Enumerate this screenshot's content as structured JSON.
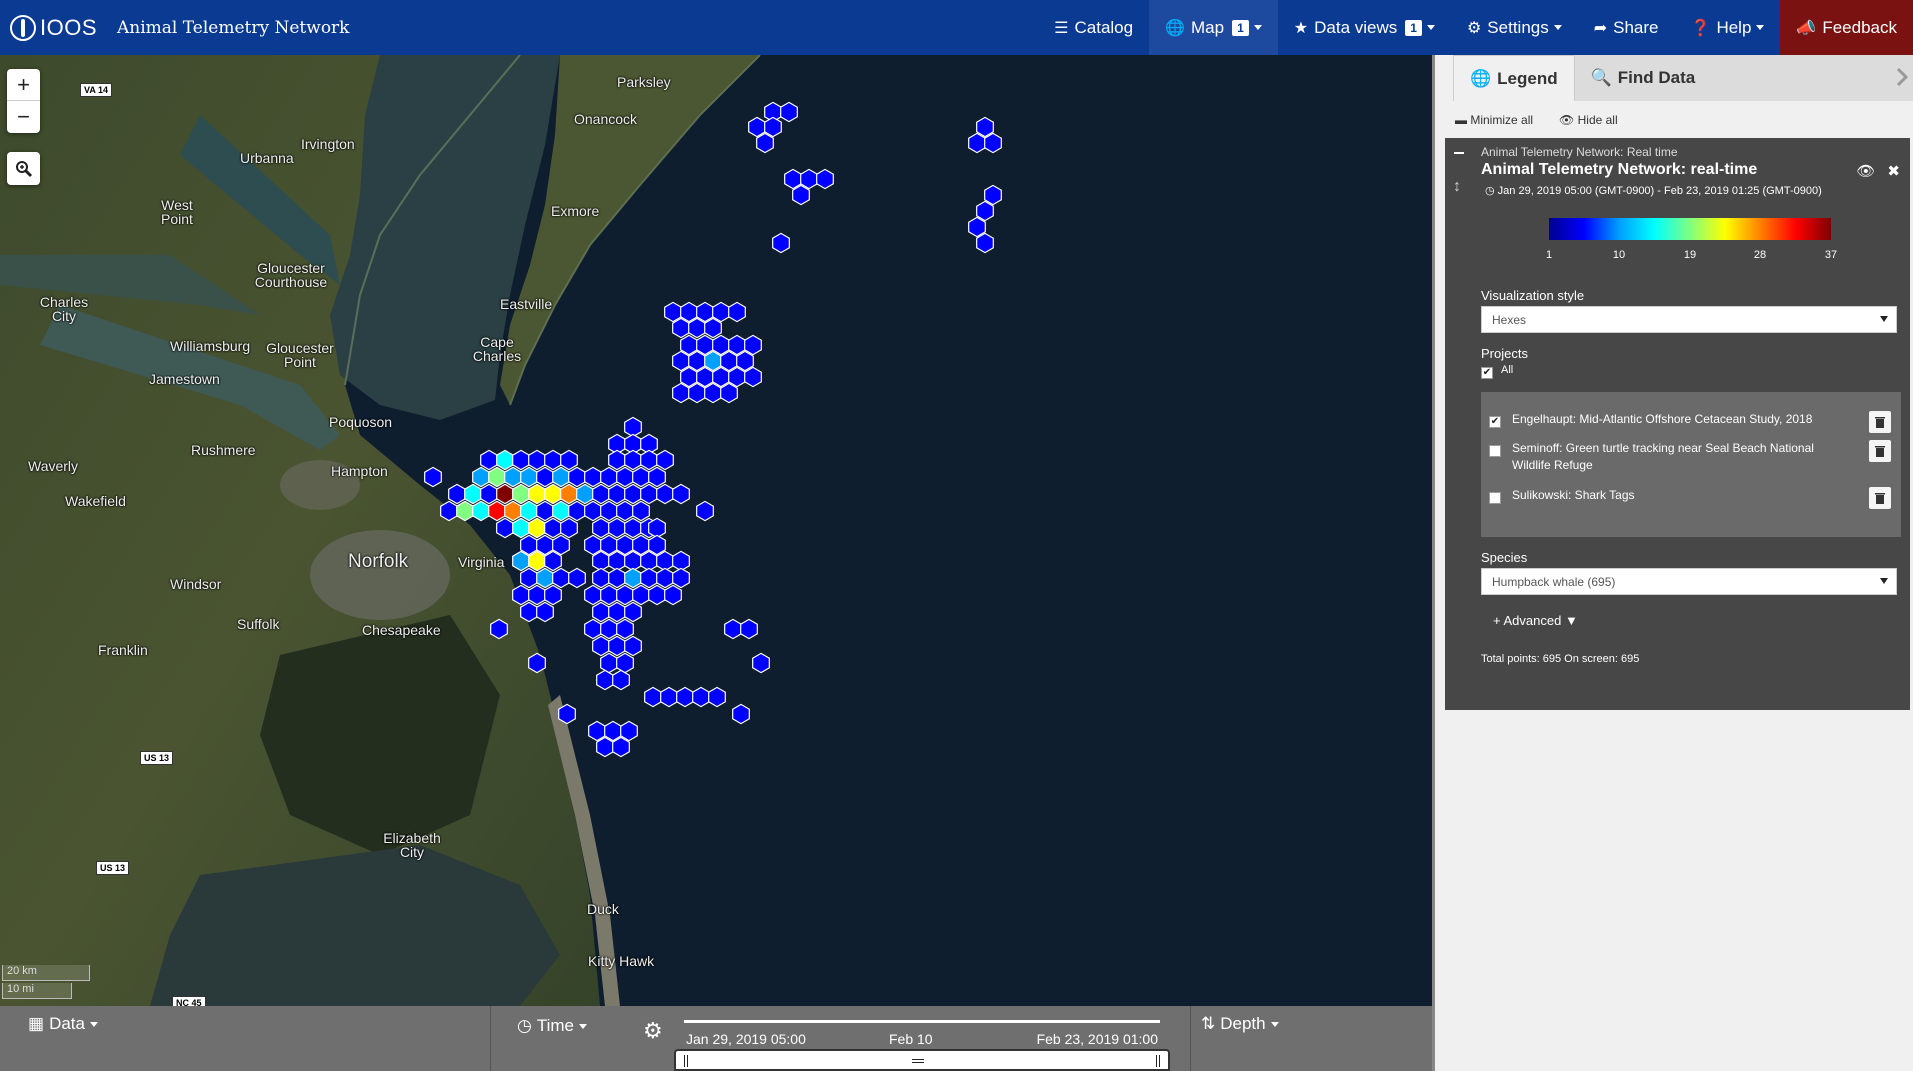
{
  "header": {
    "logo_text": "IOOS",
    "title": "Animal Telemetry Network",
    "nav": [
      {
        "label": "Catalog",
        "icon": "list-icon"
      },
      {
        "label": "Map",
        "icon": "globe-icon",
        "badge": "1"
      },
      {
        "label": "Data views",
        "icon": "star-icon",
        "badge": "1"
      },
      {
        "label": "Settings",
        "icon": "gear-icon"
      },
      {
        "label": "Share",
        "icon": "share-icon"
      },
      {
        "label": "Help",
        "icon": "help-icon"
      },
      {
        "label": "Feedback",
        "icon": "bullhorn-icon"
      }
    ]
  },
  "map": {
    "zoom_in": "+",
    "zoom_out": "−",
    "scale_km": "20 km",
    "scale_mi": "10 mi",
    "labels": [
      "Parksley",
      "Onancock",
      "Irvington",
      "Urbanna",
      "West Point",
      "Gloucester Courthouse",
      "Charles City",
      "Williamsburg",
      "Gloucester Point",
      "Jamestown",
      "Exmore",
      "Eastville",
      "Cape Charles",
      "Poquoson",
      "Rushmere",
      "Hampton",
      "Waverly",
      "Wakefield",
      "Norfolk",
      "Virginia",
      "Windsor",
      "Suffolk",
      "Chesapeake",
      "Franklin",
      "Elizabeth City",
      "Duck",
      "Kitty Hawk"
    ],
    "shields": [
      "VA 14",
      "US 13",
      "US 13",
      "NC 45"
    ]
  },
  "bottom": {
    "data_label": "Data",
    "time_label": "Time",
    "depth_label": "Depth",
    "start": "Jan 29, 2019 05:00",
    "mid": "Feb 10",
    "end": "Feb 23, 2019 01:00"
  },
  "panel": {
    "tabs": {
      "legend": "Legend",
      "find": "Find Data"
    },
    "minimize_all": "Minimize all",
    "hide_all": "Hide all",
    "layer": {
      "subtitle": "Animal Telemetry Network: Real time",
      "title": "Animal Telemetry Network: real-time",
      "date_range": "Jan 29, 2019 05:00 (GMT-0900) - Feb 23, 2019 01:25 (GMT-0900)",
      "colorbar_ticks": [
        "1",
        "10",
        "19",
        "28",
        "37"
      ],
      "viz_style_label": "Visualization style",
      "viz_style_value": "Hexes",
      "projects_label": "Projects",
      "all_label": "All",
      "projects": [
        {
          "name": "Engelhaupt: Mid-Atlantic Offshore Cetacean Study, 2018",
          "checked": true
        },
        {
          "name": "Seminoff: Green turtle tracking near Seal Beach National Wildlife Refuge",
          "checked": false
        },
        {
          "name": "Sulikowski: Shark Tags",
          "checked": false
        }
      ],
      "species_label": "Species",
      "species_value": "Humpback whale (695)",
      "advanced_label": "Advanced",
      "total_text": "Total points: 695 On screen: 695"
    }
  },
  "colors": {
    "navbar": "#0b3a93",
    "feedback": "#7a1212",
    "hex_scale": [
      "#00008f",
      "#0000ff",
      "#00a0ff",
      "#00ffff",
      "#80ff80",
      "#ffff00",
      "#ff8000",
      "#ff0000",
      "#800000"
    ]
  }
}
